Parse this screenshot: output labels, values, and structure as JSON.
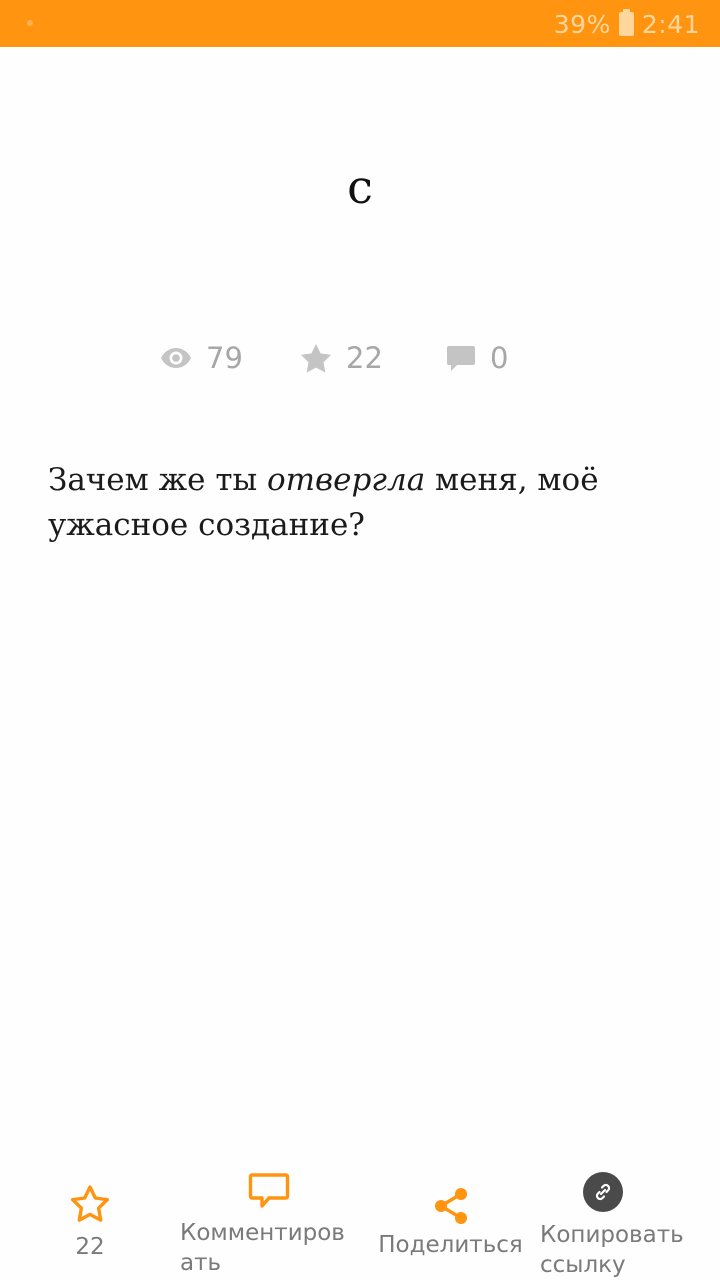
{
  "status_bar": {
    "battery": "39%",
    "time": "2:41",
    "color": "#ff9410"
  },
  "post": {
    "title": "с",
    "stats": {
      "views": "79",
      "stars": "22",
      "comments": "0"
    },
    "body_before": "Зачем же ты ",
    "body_emphasis": "отвергла",
    "body_after": " меня, моё ужасное создание?"
  },
  "actions": {
    "star_count": "22",
    "comment_label": "Комментировать",
    "share_label": "Поделиться",
    "copy_link_label": "Копировать ссылку"
  },
  "icons": {
    "stats": [
      "eye-icon",
      "star-icon",
      "comment-icon"
    ],
    "bar": [
      "star-outline-icon",
      "comment-outline-icon",
      "share-icon",
      "link-icon"
    ]
  },
  "colors": {
    "accent": "#ff9410",
    "muted": "#a7a7a7",
    "label": "#7a7a7a"
  }
}
